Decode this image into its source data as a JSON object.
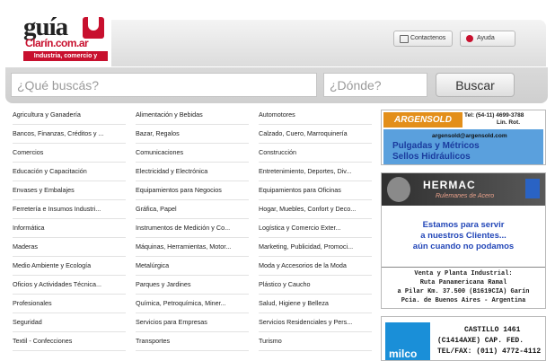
{
  "logo": {
    "word": "guía",
    "url": "Clarín.com.ar",
    "tagline": "Industria, comercio y servicios"
  },
  "header_buttons": [
    {
      "label": "Contactenos",
      "icon": "mail-icon"
    },
    {
      "label": "Ayuda",
      "icon": "help-icon"
    }
  ],
  "search": {
    "what_placeholder": "¿Qué buscás?",
    "where_placeholder": "¿Dónde?",
    "button_label": "Buscar"
  },
  "categories": [
    [
      "Agricultura y Ganadería",
      "Alimentación y Bebidas",
      "Automotores"
    ],
    [
      "Bancos, Finanzas, Créditos y ...",
      "Bazar, Regalos",
      "Calzado, Cuero, Marroquinería"
    ],
    [
      "Comercios",
      "Comunicaciones",
      "Construcción"
    ],
    [
      "Educación y Capacitación",
      "Electricidad y Electrónica",
      "Entretenimiento, Deportes, Div..."
    ],
    [
      "Envases y Embalajes",
      "Equipamientos para Negocios",
      "Equipamientos para Oficinas"
    ],
    [
      "Ferretería e Insumos Industri...",
      "Gráfica, Papel",
      "Hogar, Muebles, Confort y Deco..."
    ],
    [
      "Informática",
      "Instrumentos de Medición y Co...",
      "Logística y Comercio Exter..."
    ],
    [
      "Maderas",
      "Máquinas, Herramientas, Motor...",
      "Marketing, Publicidad, Promoci..."
    ],
    [
      "Medio Ambiente y Ecología",
      "Metalúrgica",
      "Moda y Accesorios de la Moda"
    ],
    [
      "Oficios y Actividades Técnica...",
      "Parques y Jardines",
      "Plástico y Caucho"
    ],
    [
      "Profesionales",
      "Química, Petroquímica, Miner...",
      "Salud, Higiene y Belleza"
    ],
    [
      "Seguridad",
      "Servicios para Empresas",
      "Servicios Residenciales y Pers..."
    ],
    [
      "Textil - Confecciones",
      "Transportes",
      "Turismo"
    ]
  ],
  "ads": [
    {
      "brand": "ARGENSOLD",
      "phone": "Tel: (54-11) 4699-3788",
      "lines": "Lin. Rot.",
      "email": "argensold@argensold.com",
      "text1": "Pulgadas y Métricos",
      "text2": "Sellos Hidráulicos"
    },
    {
      "brand": "HERMAC",
      "tagline": "Rulemanes de Acero",
      "blue1": "Estamos para servir",
      "blue2": "a nuestros Clientes...",
      "blue3": "aún cuando no podamos",
      "l1": "Venta y Planta Industrial:",
      "l2": "Ruta Panamericana Ramal",
      "l3": "a Pilar Km. 37.500 (B1619CIA) Garín",
      "l4": "Pcia. de Buenos Aires - Argentina"
    },
    {
      "brand": "milco",
      "l1": "CASTILLO 1461",
      "l2": "(C1414AXE) CAP. FED.",
      "l3": "TEL/FAX: (011) 4772-4112"
    }
  ],
  "colors": {
    "brand_red": "#c8102e",
    "ad_orange": "#e38f1a",
    "ad_blue": "#5aa0dd"
  }
}
